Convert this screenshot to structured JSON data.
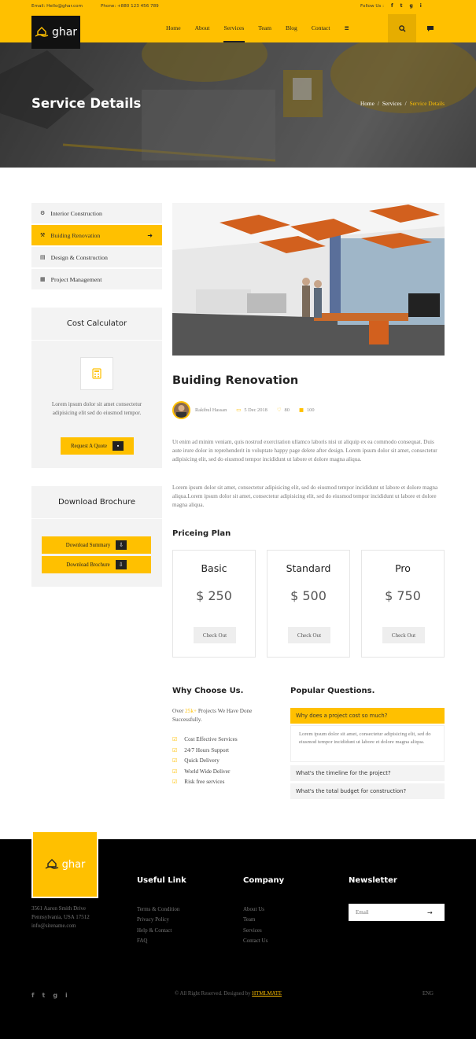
{
  "topbar": {
    "email": "Email: Hello@ghar.com",
    "phone": "Phone: +880 123 456 789",
    "follow": "Follow Us :",
    "social": [
      "f",
      "t",
      "g",
      "i"
    ]
  },
  "brand": {
    "name": "ghar",
    "accent": "#ffc000",
    "dark": "#111111"
  },
  "nav": {
    "items": [
      "Home",
      "About",
      "Services",
      "Team",
      "Blog",
      "Contact",
      "≡"
    ],
    "active": "Services"
  },
  "banner": {
    "title": "Service Details",
    "breadcrumb": [
      "Home",
      "Services",
      "Service Details"
    ]
  },
  "sidebar": {
    "services": [
      {
        "icon": "gear-icon",
        "label": "Interior Construction"
      },
      {
        "icon": "hammer-icon",
        "label": "Buiding Renovation"
      },
      {
        "icon": "blueprint-icon",
        "label": "Design & Construction"
      },
      {
        "icon": "clipboard-icon",
        "label": "Project Management"
      }
    ],
    "calc": {
      "title": "Cost Calculator",
      "text": "Lorem ipsum dolor sit amet consectetur adipisicing elit sed do eiusmod tempor.",
      "button": "Request A Quote"
    },
    "brochure": {
      "title": "Download Brochure",
      "buttons": [
        "Download Summary",
        "Download Brochure"
      ]
    }
  },
  "post": {
    "title": "Buiding Renovation",
    "author": "Rakibul Hassan",
    "date": "5 Dec 2018",
    "likes": "80",
    "comments": "100",
    "para1": "Ut enim ad minim veniam, quis nostrud exercitation ullamco laboris nisi ut aliquip ex ea commodo consequat. Duis aute irure dolor in reprehenderit in voluptate happy page delete after design. Lorem ipsum dolor sit amet, consectetur adipisicing elit, sed do eiusmod tempor incididunt ut labore et dolore magna aliqua.",
    "para2": "Lorem ipsum dolor sit amet, consectetur adipisicing elit, sed do eiusmod tempor incididunt ut labore et dolore magna aliqua.Lorem ipsum dolor sit amet, consectetur adipisicing elit, sed do eiusmod tempor incididunt ut labore et dolore magna aliqua."
  },
  "pricing": {
    "title": "Priceing Plan",
    "plans": [
      {
        "name": "Basic",
        "price": "$ 250",
        "button": "Check Out"
      },
      {
        "name": "Standard",
        "price": "$ 500",
        "button": "Check Out"
      },
      {
        "name": "Pro",
        "price": "$ 750",
        "button": "Check Out"
      }
    ]
  },
  "why": {
    "title": "Why Choose Us.",
    "intro_a": "Over ",
    "intro_num": "25k+",
    "intro_b": " Projects We Have Done Successfully.",
    "items": [
      "Cost Effective Services",
      "24/7 Hours Support",
      "Quick Delivery",
      "World Wide Deliver",
      "Risk free services"
    ]
  },
  "faq": {
    "title": "Popular Questions.",
    "open_q": "Why does a project cost so much?",
    "open_a": "Lorem ipsum dolor sit amet, consectetur adipisicing elit, sed do eiusmod tempor incididunt ut labore et dolore magna aliqua.",
    "others": [
      "What's the timeline for the project?",
      "What's the total budget for construction?"
    ]
  },
  "footer": {
    "address": [
      "3561 Aaron Smith Drive",
      "Pennsylvania, USA 17512",
      "info@sitename.com"
    ],
    "useful": {
      "title": "Useful Link",
      "links": [
        "Terms & Condition",
        "Privacy Policy",
        "Help & Contact",
        "FAQ"
      ]
    },
    "company": {
      "title": "Company",
      "links": [
        "About Us",
        "Team",
        "Services",
        "Contact Us"
      ]
    },
    "newsletter": {
      "title": "Newsletter",
      "placeholder": "Email"
    },
    "copyright": "© All Right Reserved. Designed by ",
    "designer": "HTMLMATE",
    "lang": "ENG"
  }
}
